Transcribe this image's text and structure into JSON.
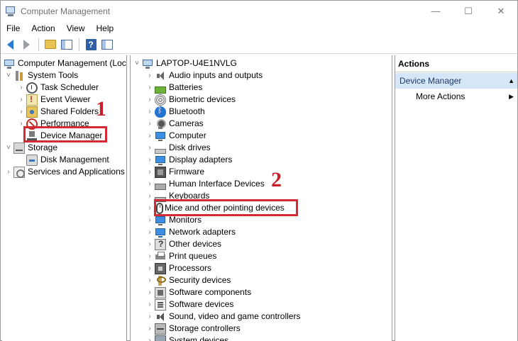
{
  "window": {
    "title": "Computer Management",
    "controls": [
      "—",
      "☐",
      "✕"
    ]
  },
  "menu": [
    "File",
    "Action",
    "View",
    "Help"
  ],
  "toolbar": {
    "buttons": [
      "back-arrow-icon",
      "forward-arrow-icon",
      "up-folder-icon",
      "show-hide-tree-icon",
      "help-icon",
      "action-pane-icon"
    ],
    "help_label": "?"
  },
  "left_tree": [
    {
      "label": "Computer Management (Local)",
      "chev": "",
      "icon": "computer-icon"
    },
    {
      "label": "System Tools",
      "chev": "˅",
      "icon": "tools-icon"
    },
    {
      "label": "Task Scheduler",
      "chev": "›",
      "icon": "clock-icon"
    },
    {
      "label": "Event Viewer",
      "chev": "›",
      "icon": "event-viewer-icon"
    },
    {
      "label": "Shared Folders",
      "chev": "›",
      "icon": "shared-folder-icon"
    },
    {
      "label": "Performance",
      "chev": "›",
      "icon": "performance-icon"
    },
    {
      "label": "Device Manager",
      "chev": "",
      "icon": "device-manager-icon"
    },
    {
      "label": "Storage",
      "chev": "˅",
      "icon": "storage-icon"
    },
    {
      "label": "Disk Management",
      "chev": "",
      "icon": "disk-icon"
    },
    {
      "label": "Services and Applications",
      "chev": "›",
      "icon": "services-icon"
    }
  ],
  "center_tree": {
    "root": {
      "label": "LAPTOP-U4E1NVLG",
      "chev": "˅",
      "icon": "computer-icon"
    },
    "items": [
      {
        "label": "Audio inputs and outputs",
        "icon": "speaker-icon"
      },
      {
        "label": "Batteries",
        "icon": "battery-icon"
      },
      {
        "label": "Biometric devices",
        "icon": "fingerprint-icon"
      },
      {
        "label": "Bluetooth",
        "icon": "bluetooth-icon"
      },
      {
        "label": "Cameras",
        "icon": "camera-icon"
      },
      {
        "label": "Computer",
        "icon": "monitor-icon"
      },
      {
        "label": "Disk drives",
        "icon": "disk-drive-icon"
      },
      {
        "label": "Display adapters",
        "icon": "display-adapter-icon"
      },
      {
        "label": "Firmware",
        "icon": "firmware-icon"
      },
      {
        "label": "Human Interface Devices",
        "icon": "hid-icon"
      },
      {
        "label": "Keyboards",
        "icon": "keyboard-icon"
      },
      {
        "label": "Mice and other pointing devices",
        "icon": "mouse-icon"
      },
      {
        "label": "Monitors",
        "icon": "monitor-icon"
      },
      {
        "label": "Network adapters",
        "icon": "network-adapter-icon"
      },
      {
        "label": "Other devices",
        "icon": "other-devices-icon"
      },
      {
        "label": "Print queues",
        "icon": "printer-icon"
      },
      {
        "label": "Processors",
        "icon": "processor-icon"
      },
      {
        "label": "Security devices",
        "icon": "security-key-icon"
      },
      {
        "label": "Software components",
        "icon": "software-component-icon"
      },
      {
        "label": "Software devices",
        "icon": "software-device-icon"
      },
      {
        "label": "Sound, video and game controllers",
        "icon": "sound-icon"
      },
      {
        "label": "Storage controllers",
        "icon": "storage-controller-icon"
      },
      {
        "label": "System devices",
        "icon": "system-device-icon"
      }
    ],
    "item_chev": "›"
  },
  "actions": {
    "header": "Actions",
    "section": "Device Manager",
    "section_arrow": "▲",
    "items": [
      {
        "label": "More Actions",
        "arrow": "▶"
      }
    ]
  },
  "annotations": {
    "step1": "1",
    "step2": "2",
    "highlight_color": "#d42a36"
  }
}
